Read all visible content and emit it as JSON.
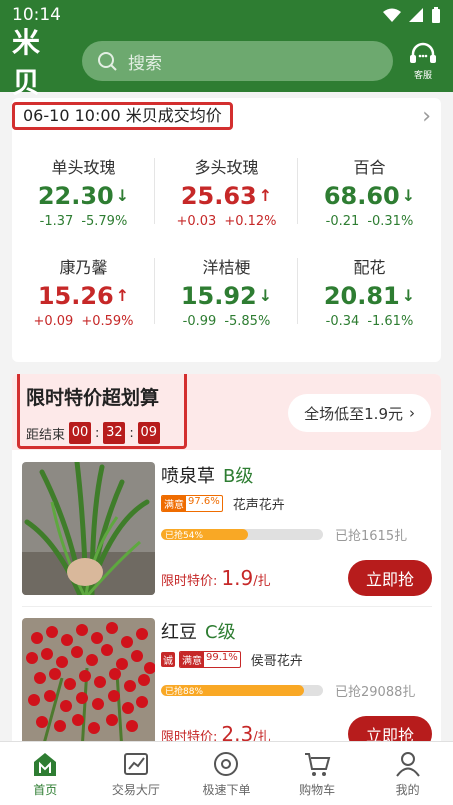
{
  "status_bar": {
    "time": "10:14"
  },
  "header": {
    "logo": "米贝",
    "search_placeholder": "搜索",
    "service_label": "客服"
  },
  "price_board": {
    "title": "06-10 10:00 米贝成交均价",
    "items": [
      {
        "name": "单头玫瑰",
        "price": "22.30",
        "trend": "down",
        "change": "-1.37",
        "percent": "-5.79%"
      },
      {
        "name": "多头玫瑰",
        "price": "25.63",
        "trend": "up",
        "change": "+0.03",
        "percent": "+0.12%"
      },
      {
        "name": "百合",
        "price": "68.60",
        "trend": "down",
        "change": "-0.21",
        "percent": "-0.31%"
      },
      {
        "name": "康乃馨",
        "price": "15.26",
        "trend": "up",
        "change": "+0.09",
        "percent": "+0.59%"
      },
      {
        "name": "洋桔梗",
        "price": "15.92",
        "trend": "down",
        "change": "-0.99",
        "percent": "-5.85%"
      },
      {
        "name": "配花",
        "price": "20.81",
        "trend": "down",
        "change": "-0.34",
        "percent": "-1.61%"
      }
    ]
  },
  "flash_sale": {
    "title": "限时特价超划算",
    "countdown_label": "距结束",
    "hours": "00",
    "minutes": "32",
    "seconds": "09",
    "promo_button": "全场低至1.9元",
    "products": [
      {
        "name": "喷泉草",
        "grade": "B级",
        "satisfaction_label": "满意",
        "satisfaction": "97.6%",
        "shop": "花声花卉",
        "sold_percent_text": "已抢54%",
        "sold_percent": 54,
        "grabbed": "已抢1615扎",
        "price_label": "限时特价:",
        "price": "1.9",
        "unit": "/扎",
        "buy_label": "立即抢"
      },
      {
        "name": "红豆",
        "grade": "C级",
        "honest_label": "诚",
        "satisfaction_label": "满意",
        "satisfaction": "99.1%",
        "shop": "侯哥花卉",
        "sold_percent_text": "已抢88%",
        "sold_percent": 88,
        "grabbed": "已抢29088扎",
        "price_label": "限时特价:",
        "price": "2.3",
        "unit": "/扎",
        "buy_label": "立即抢"
      }
    ]
  },
  "tab_bar": {
    "tabs": [
      {
        "label": "首页",
        "icon": "home-icon"
      },
      {
        "label": "交易大厅",
        "icon": "chart-icon"
      },
      {
        "label": "极速下单",
        "icon": "fast-order-icon"
      },
      {
        "label": "购物车",
        "icon": "cart-icon"
      },
      {
        "label": "我的",
        "icon": "user-icon"
      }
    ]
  },
  "colors": {
    "brand_green": "#2e7d32",
    "down_green": "#2e7d32",
    "up_red": "#c62828",
    "buy_red": "#b71c1c"
  }
}
